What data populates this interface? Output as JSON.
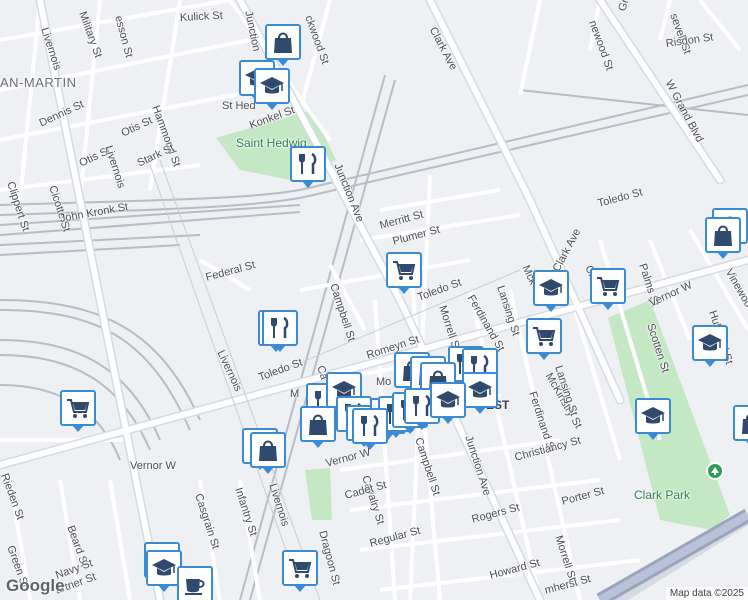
{
  "map": {
    "district_label": "AN-MARTIN",
    "neighborhood_fragment": "EST",
    "park_labels": {
      "hedwig": "Saint Hedwig",
      "clark": "Clark Park"
    },
    "attribution": "Map data ©2025",
    "logo": "Google"
  },
  "streets": [
    {
      "id": "kulick",
      "text": "Kulick St"
    },
    {
      "id": "pierson",
      "text": "esson St"
    },
    {
      "id": "military",
      "text": "Military St"
    },
    {
      "id": "livernois_top",
      "text": "Livernois"
    },
    {
      "id": "junction_top",
      "text": "Junction"
    },
    {
      "id": "lockwood",
      "text": "ckwood St"
    },
    {
      "id": "clark_ave_top",
      "text": "Clark Ave"
    },
    {
      "id": "wood",
      "text": "newood St"
    },
    {
      "id": "grand_blvd",
      "text": "Grand Blvd"
    },
    {
      "id": "roosevelt",
      "text": "sevelt St"
    },
    {
      "id": "risdon",
      "text": "Risdon St"
    },
    {
      "id": "w_grand_blvd",
      "text": "W Grand Blvd"
    },
    {
      "id": "hammond",
      "text": "Hammond St"
    },
    {
      "id": "st_hedwig",
      "text": "St Hed"
    },
    {
      "id": "dennis",
      "text": "Dennis St"
    },
    {
      "id": "otis1",
      "text": "Otis St"
    },
    {
      "id": "otis2",
      "text": "Otis St"
    },
    {
      "id": "konkel",
      "text": "Konkel St"
    },
    {
      "id": "stark",
      "text": "Stark St"
    },
    {
      "id": "clippert",
      "text": "Clippert St"
    },
    {
      "id": "cicotte",
      "text": "Cicotte St"
    },
    {
      "id": "livernois_mid",
      "text": "Livernois"
    },
    {
      "id": "junction_ave",
      "text": "Junction Ave"
    },
    {
      "id": "john_kronk",
      "text": "John Kronk St"
    },
    {
      "id": "merritt",
      "text": "Merritt St"
    },
    {
      "id": "plumer",
      "text": "Plumer St"
    },
    {
      "id": "toledo_right",
      "text": "Toledo St"
    },
    {
      "id": "federal",
      "text": "Federal St"
    },
    {
      "id": "campbell",
      "text": "Campbell St"
    },
    {
      "id": "toledo_mid",
      "text": "Toledo St"
    },
    {
      "id": "morrell",
      "text": "Morrell St"
    },
    {
      "id": "ferdinand",
      "text": "Ferdinand St"
    },
    {
      "id": "lansing",
      "text": "Lansing St"
    },
    {
      "id": "clark_ave_mid",
      "text": "Clark Ave"
    },
    {
      "id": "mckinstry_top",
      "text": "Mck"
    },
    {
      "id": "clark_mid2",
      "text": "Clark"
    },
    {
      "id": "palms",
      "text": "Palms St"
    },
    {
      "id": "vernor_right",
      "text": "Vernor W"
    },
    {
      "id": "viewood",
      "text": "Vinewoo"
    },
    {
      "id": "hubbard",
      "text": "Hubbard St"
    },
    {
      "id": "scotten",
      "text": "Scotten St"
    },
    {
      "id": "romeyn",
      "text": "Romeyn St"
    },
    {
      "id": "toledo_left",
      "text": "Toledo St"
    },
    {
      "id": "livernois_low",
      "text": "Livernois"
    },
    {
      "id": "mckinstry",
      "text": "McKinstry St"
    },
    {
      "id": "lansing2",
      "text": "Lansing St"
    },
    {
      "id": "ferdinand2",
      "text": "Ferdinand St"
    },
    {
      "id": "campbell2",
      "text": "Campbell St"
    },
    {
      "id": "junction_ave2",
      "text": "Junction Ave"
    },
    {
      "id": "christiancy",
      "text": "Christiancy St"
    },
    {
      "id": "vernor_w",
      "text": "Vernor W"
    },
    {
      "id": "vernor_w2",
      "text": "Vernor W"
    },
    {
      "id": "cavalry",
      "text": "Cavalry St"
    },
    {
      "id": "cadet",
      "text": "Cadet St"
    },
    {
      "id": "rieden",
      "text": "Rieden St"
    },
    {
      "id": "casgrain",
      "text": "Casgrain St"
    },
    {
      "id": "infantry",
      "text": "Infantry St"
    },
    {
      "id": "livernois_bot",
      "text": "Livernois"
    },
    {
      "id": "dragoon",
      "text": "Dragoon St"
    },
    {
      "id": "beard",
      "text": "Beard St"
    },
    {
      "id": "green",
      "text": "Green St"
    },
    {
      "id": "navy",
      "text": "Navy St"
    },
    {
      "id": "partner",
      "text": "artner St"
    },
    {
      "id": "regular",
      "text": "Regular St"
    },
    {
      "id": "rogers",
      "text": "Rogers St"
    },
    {
      "id": "porter",
      "text": "Porter St"
    },
    {
      "id": "howard",
      "text": "Howard St"
    },
    {
      "id": "amherst",
      "text": "mherst St"
    },
    {
      "id": "morrell2",
      "text": "Morrell St"
    },
    {
      "id": "mo",
      "text": "Mo"
    },
    {
      "id": "ca",
      "text": "Ca"
    },
    {
      "id": "m",
      "text": "M"
    }
  ],
  "markers": [
    {
      "type": "shopping",
      "name": "shopping-bag-marker"
    },
    {
      "type": "grocery",
      "name": "grocery-cart-marker"
    },
    {
      "type": "school",
      "name": "school-cap-marker"
    },
    {
      "type": "restaurant",
      "name": "restaurant-marker"
    },
    {
      "type": "cafe",
      "name": "cafe-cup-marker"
    }
  ]
}
